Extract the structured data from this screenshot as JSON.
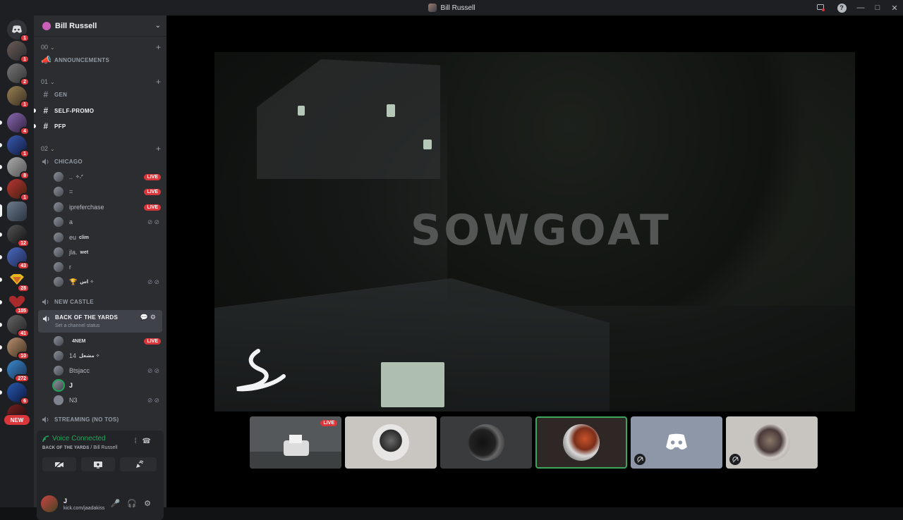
{
  "window": {
    "title": "Bill Russell"
  },
  "rail": {
    "servers": [
      {
        "badge": "1"
      },
      {
        "badge": "1"
      },
      {
        "badge": "2"
      },
      {
        "badge": "1"
      },
      {
        "badge": "4"
      },
      {
        "badge": "1"
      },
      {
        "badge": "8"
      },
      {
        "badge": "1"
      },
      {
        "badge": ""
      },
      {
        "badge": "12"
      },
      {
        "badge": "43"
      },
      {
        "badge": "28"
      },
      {
        "badge": "105"
      },
      {
        "badge": "41"
      },
      {
        "badge": "10"
      },
      {
        "badge": "272"
      },
      {
        "badge": "6"
      }
    ],
    "new_label": "NEW"
  },
  "guild": {
    "name": "Bill Russell"
  },
  "categories": [
    {
      "label": "00"
    },
    {
      "label": "01"
    },
    {
      "label": "02"
    }
  ],
  "channels": {
    "announcements": "ANNOUNCEMENTS",
    "gen": "GEN",
    "self_promo": "SELF-PROMO",
    "pfp": "PFP",
    "chicago": "CHICAGO",
    "new_castle": "NEW CASTLE",
    "back_of_the_yards": "BACK OF THE YARDS",
    "set_status": "Set a channel status",
    "streaming": "STREAMING (NO TOS)"
  },
  "chicago_users": [
    {
      "name": "..",
      "tag": "✧.ᐟ",
      "live": "LIVE"
    },
    {
      "name": "=",
      "tag": "",
      "live": "LIVE"
    },
    {
      "name": "ipreferchase",
      "tag": "",
      "live": "LIVE"
    },
    {
      "name": "a",
      "tag": "",
      "live": ""
    },
    {
      "name": "eu",
      "tag": "clim",
      "live": ""
    },
    {
      "name": "jla.",
      "tag": "wet",
      "live": ""
    },
    {
      "name": "r",
      "tag": "",
      "live": ""
    },
    {
      "name": "🏆",
      "tag": "اس ✧",
      "live": ""
    }
  ],
  "yards_users": [
    {
      "name": "",
      "tag": "4NEM",
      "live": "LIVE"
    },
    {
      "name": "14",
      "tag": "مشعل ✧",
      "live": ""
    },
    {
      "name": "Btsjacc",
      "tag": "",
      "live": ""
    },
    {
      "name": "J",
      "tag": "",
      "live": ""
    },
    {
      "name": "N3",
      "tag": "",
      "live": ""
    }
  ],
  "voice": {
    "status": "Voice Connected",
    "channel": "BACK OF THE YARDS",
    "server": "Bill Russell"
  },
  "user": {
    "name": "J",
    "status": "kick.com/jaadakiss"
  },
  "stream": {
    "watermark": "SOWGOAT"
  },
  "tiles": [
    {
      "live": "LIVE",
      "bg": "#5b5f5c"
    },
    {
      "live": "",
      "bg": "#c9c5c0"
    },
    {
      "live": "",
      "bg": "#3a3b3d"
    },
    {
      "live": "",
      "bg": "#2f2626"
    },
    {
      "live": "",
      "bg": "#8e97a8"
    },
    {
      "live": "",
      "bg": "#c8c4c0"
    }
  ],
  "colors": {
    "accent_live": "#da373c",
    "voice_green": "#23a55a",
    "speaking_border": "#3ba55c"
  }
}
